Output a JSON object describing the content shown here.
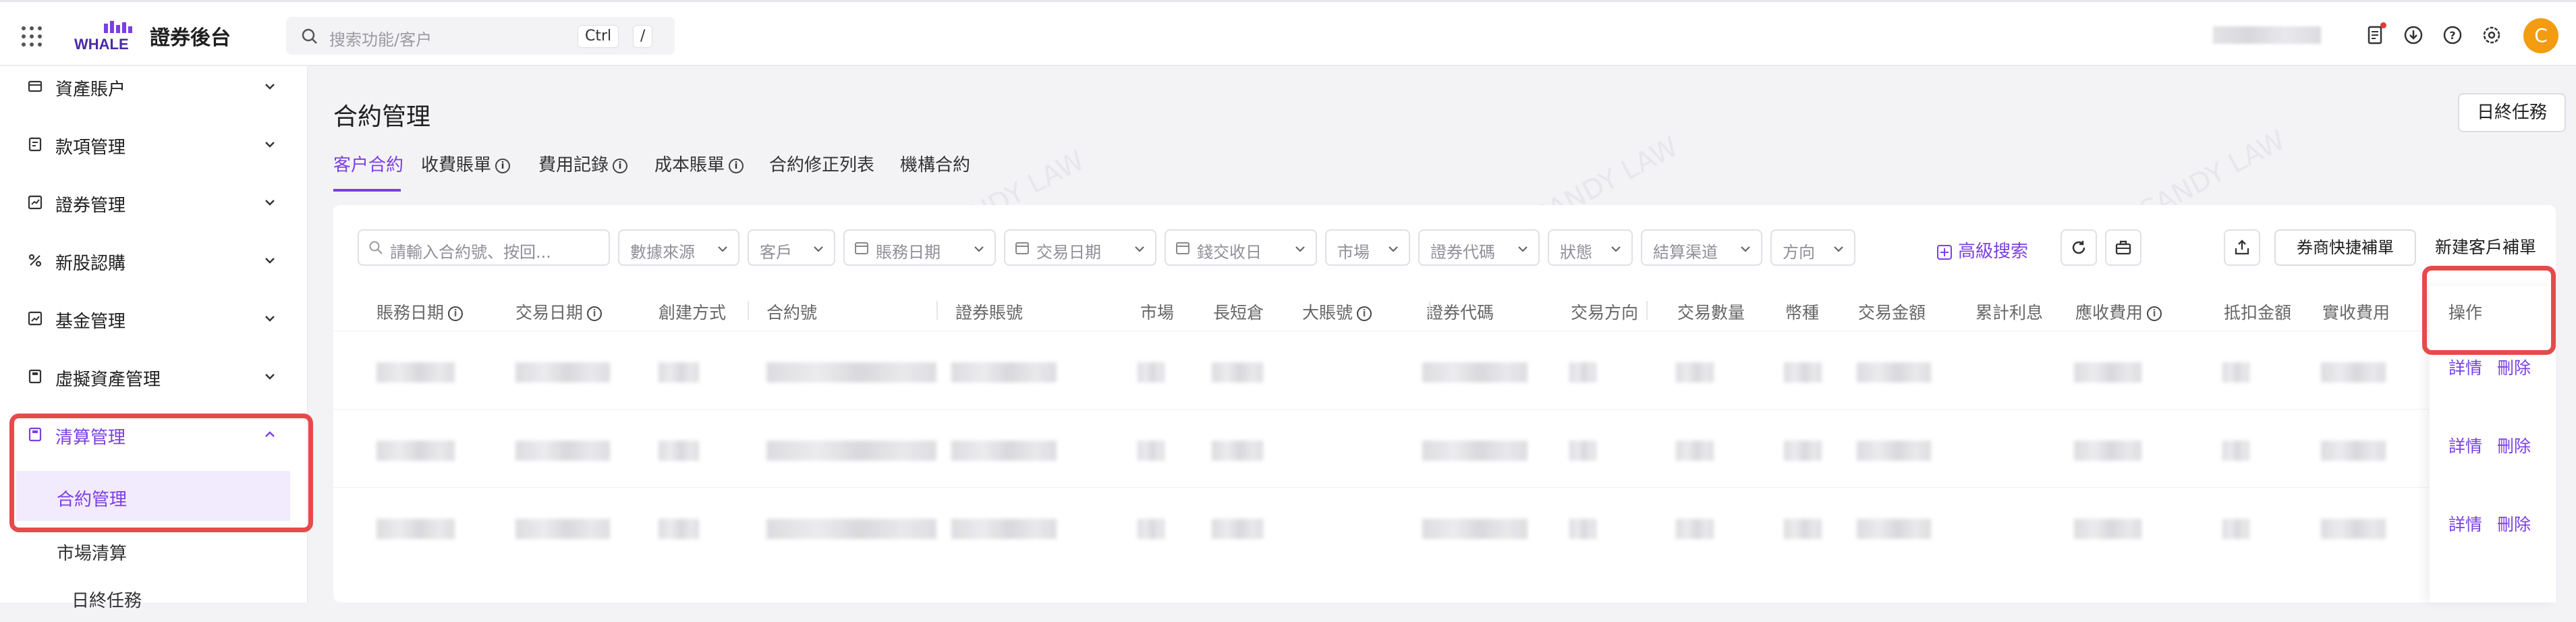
{
  "header": {
    "logo_text": "WHALE",
    "app_title": "證券後台",
    "search_placeholder": "搜索功能/客户",
    "shortcut_key1": "Ctrl",
    "shortcut_key2": "/",
    "avatar_letter": "C"
  },
  "sidebar": {
    "items": [
      {
        "label": "資產賬户"
      },
      {
        "label": "款項管理"
      },
      {
        "label": "證券管理"
      },
      {
        "label": "新股認購"
      },
      {
        "label": "基金管理"
      },
      {
        "label": "虛擬資產管理"
      },
      {
        "label": "清算管理"
      }
    ],
    "sub_items": [
      {
        "label": "合約管理"
      },
      {
        "label": "市場清算"
      },
      {
        "label": "日終任務"
      }
    ]
  },
  "main": {
    "page_title": "合約管理",
    "end_task_button": "日終任務",
    "tabs": [
      {
        "label": "客户合約"
      },
      {
        "label": "收費賬單"
      },
      {
        "label": "費用記錄"
      },
      {
        "label": "成本賬單"
      },
      {
        "label": "合約修正列表"
      },
      {
        "label": "機構合約"
      }
    ],
    "filters": {
      "search_placeholder": "請輸入合約號、按回...",
      "data_source": "數據來源",
      "client": "客戶",
      "account_date": "賬務日期",
      "trade_date": "交易日期",
      "settle_date": "錢交收日",
      "market": "市場",
      "security_code": "證券代碼",
      "status": "狀態",
      "settle_channel": "結算渠道",
      "direction": "方向",
      "advanced_search": "高級搜索"
    },
    "buttons": {
      "quick_supplement": "券商快捷補單",
      "new_client_supplement": "新建客戶補單"
    },
    "table": {
      "columns": [
        "賬務日期",
        "交易日期",
        "創建方式",
        "合約號",
        "證券賬號",
        "市場",
        "長短倉",
        "大賬號",
        "證券代碼",
        "交易方向",
        "交易數量",
        "幣種",
        "交易金額",
        "累計利息",
        "應收費用",
        "抵扣金額",
        "實收費用",
        "操作"
      ],
      "row_actions": [
        {
          "detail": "詳情",
          "delete": "刪除"
        },
        {
          "detail": "詳情",
          "delete": "刪除"
        },
        {
          "detail": "詳情",
          "delete": "刪除"
        }
      ]
    },
    "watermark_text": "CANDY LAW"
  },
  "colors": {
    "accent": "#7b3fe4",
    "highlight": "#e64a4a",
    "avatar": "#f39c12"
  }
}
